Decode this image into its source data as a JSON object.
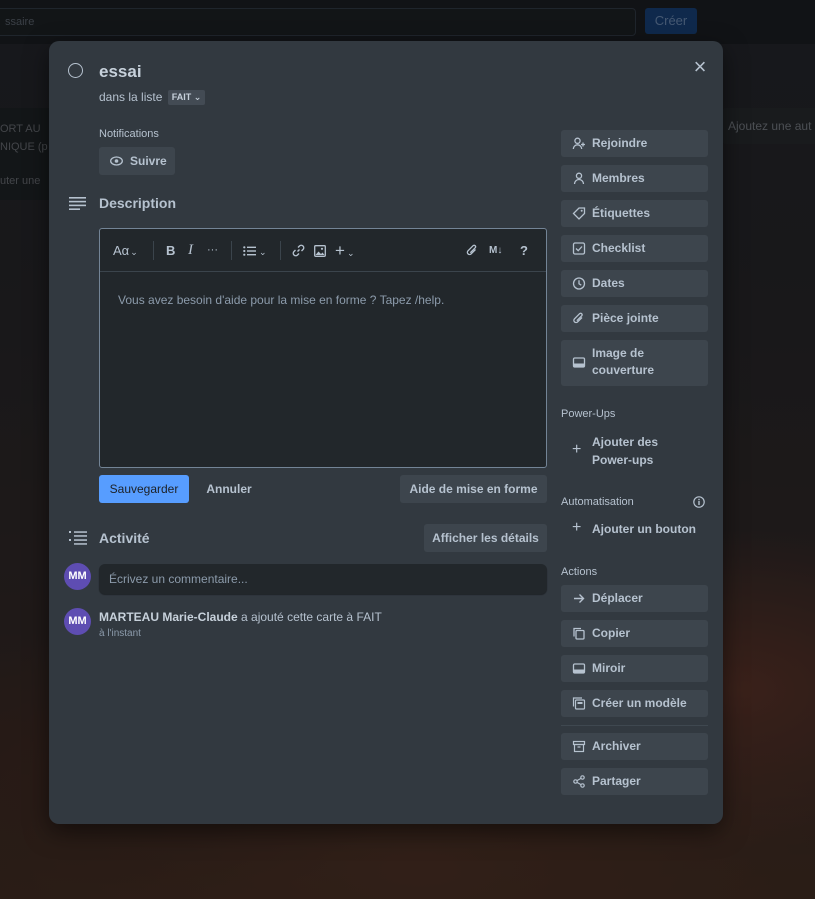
{
  "background": {
    "search_placeholder": "ssaire",
    "create_label": "Créer",
    "list_lines": [
      "ORT AU",
      "NIQUE (p",
      "uter une"
    ],
    "add_list_label": "Ajoutez une aut"
  },
  "card": {
    "title": "essai",
    "list_prefix": "dans la liste",
    "list_name": "FAIT",
    "close_icon": "×"
  },
  "notifications": {
    "label": "Notifications",
    "follow_button": "Suivre"
  },
  "description": {
    "title": "Description",
    "toolbar": {
      "text_style": "Aα",
      "bold": "B",
      "italic": "I",
      "more": "···",
      "list": "☰",
      "insert": "+",
      "markdown": "M↓",
      "help": "?"
    },
    "placeholder": "Vous avez besoin d'aide pour la mise en forme ? Tapez /help.",
    "save_button": "Sauvegarder",
    "cancel_button": "Annuler",
    "formatting_help_button": "Aide de mise en forme"
  },
  "activity": {
    "title": "Activité",
    "show_details_button": "Afficher les détails",
    "comment_placeholder": "Écrivez un commentaire...",
    "avatar_initials": "MM",
    "entry": {
      "user": "MARTEAU Marie-Claude",
      "text": "a ajouté cette carte à FAIT",
      "time": "à l'instant"
    }
  },
  "sidebar": {
    "items": [
      {
        "label": "Rejoindre",
        "icon": "user-plus-icon"
      },
      {
        "label": "Membres",
        "icon": "user-icon"
      },
      {
        "label": "Étiquettes",
        "icon": "tag-icon"
      },
      {
        "label": "Checklist",
        "icon": "checkbox-icon"
      },
      {
        "label": "Dates",
        "icon": "clock-icon"
      },
      {
        "label": "Pièce jointe",
        "icon": "paperclip-icon"
      },
      {
        "label_line1": "Image de",
        "label_line2": "couverture",
        "icon": "cover-icon"
      }
    ],
    "powerups": {
      "label": "Power-Ups",
      "add_line1": "Ajouter des",
      "add_line2": "Power-ups"
    },
    "automation": {
      "label": "Automatisation",
      "add_button": "Ajouter un bouton"
    },
    "actions": {
      "label": "Actions",
      "items": [
        {
          "label": "Déplacer",
          "icon": "arrow-right-icon"
        },
        {
          "label": "Copier",
          "icon": "copy-icon"
        },
        {
          "label": "Miroir",
          "icon": "mirror-icon"
        },
        {
          "label": "Créer un modèle",
          "icon": "template-icon"
        },
        {
          "label": "Archiver",
          "icon": "archive-icon"
        },
        {
          "label": "Partager",
          "icon": "share-icon"
        }
      ]
    }
  },
  "colors": {
    "modal_bg": "#323940",
    "button_bg": "#3d454d",
    "primary": "#579dff",
    "avatar": "#5e4db2"
  }
}
